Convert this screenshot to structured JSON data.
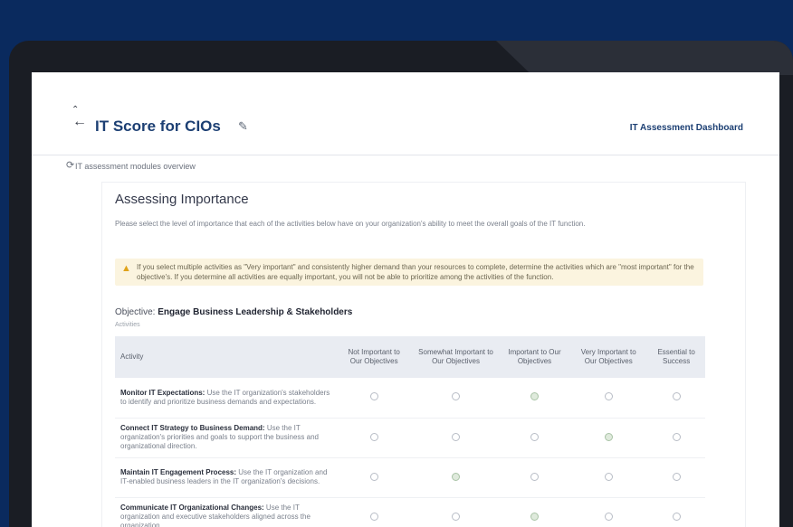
{
  "header": {
    "title": "IT Score for CIOs",
    "link": "IT Assessment Dashboard",
    "back_icon": "back-arrow-icon",
    "edit_icon": "pencil-icon"
  },
  "sub_bar": {
    "text": "IT assessment modules overview"
  },
  "section": {
    "title": "Assessing Importance",
    "description": "Please select the level of importance that each of the activities below have on your organization's ability to meet the overall goals of the IT function."
  },
  "alert": {
    "text": "If you select multiple activities as \"Very important\" and consistently higher demand than your resources to complete, determine the activities which are \"most important\" for the objective's. If you determine all activities are equally important, you will not be able to prioritize among the activities of the function."
  },
  "category": {
    "prefix": "Objective:",
    "name": "Engage Business Leadership & Stakeholders",
    "note": "Activities"
  },
  "table": {
    "headers": [
      "Activity",
      "Not Important to Our Objectives",
      "Somewhat Important to Our Objectives",
      "Important to Our Objectives",
      "Very Important to Our Objectives",
      "Essential to Success"
    ],
    "rows": [
      {
        "title": "Monitor IT Expectations:",
        "text": "Use the IT organization's stakeholders to identify and prioritize business demands and expectations."
      },
      {
        "title": "Connect IT Strategy to Business Demand:",
        "text": "Use the IT organization's priorities and goals to support the business and organizational direction."
      },
      {
        "title": "Maintain IT Engagement Process:",
        "text": "Use the IT organization and IT-enabled business leaders in the IT organization's decisions."
      },
      {
        "title": "Communicate IT Organizational Changes:",
        "text": "Use the IT organization and executive stakeholders aligned across the organization."
      }
    ]
  },
  "colors": {
    "background": "#0a2a5e",
    "accent": "#1c3f73",
    "alert_bg": "#fbf4df",
    "alert_icon": "#e0a31a"
  }
}
